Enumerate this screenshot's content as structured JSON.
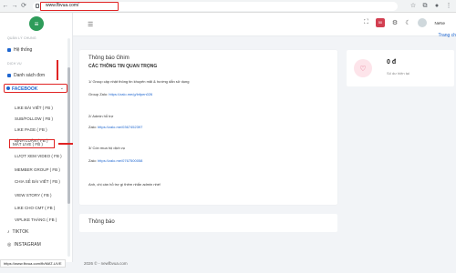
{
  "browser": {
    "url": "www.fbvua.com/",
    "status_url": "https://www.fbvua.com/fb/MAT-LIVE"
  },
  "sidebar": {
    "section_main": "QUẢN LÝ CHUNG",
    "home": "Hệ thống",
    "section_service": "DỊCH VỤ",
    "services_list": "Danh sách đơn",
    "active_group": "FACEBOOK",
    "sub_items": [
      "LIKE BÀI VIẾT ( FB )",
      "SUB/FOLLOW ( FB )",
      "LIKE PAGE ( FB )",
      "BÌNH LUẬN ( FB )",
      "MẮT LIVE ( FB )",
      "LƯỢT XEM VIDEO ( FB )",
      "MEMBER GROUP ( FB )",
      "CHIA SẺ BÀI VIẾT ( FB )",
      "VIEW STORY ( FB )",
      "LIKE CHO CMT ( FB )",
      "VIPLIKE THÁNG ( FB )"
    ],
    "tiktok": "TIKTOK",
    "instagram": "INSTAGRAM"
  },
  "header": {
    "badge": "50",
    "user": "NeNe",
    "link": "Trang ch"
  },
  "main": {
    "title": "Thông báo Ghim",
    "heading": "CÁC THÔNG TIN QUAN TRỌNG",
    "lines": [
      "1/ Group cập nhật thông tin khuyến mãi & hướng dẫn sử dụng",
      "Group Zalo: ",
      "https://zalo.me/g/lnfpen026",
      "2/ Admin hỗ trợ",
      "Zalo: ",
      "https://zalo.me/0367452397",
      "3/ Còn mua hộ dịch vụ",
      "Zalo: ",
      "https://zalo.me/0767500058",
      "Anh, chị cần hỗ trợ gì thêm nhắn admin nhé!"
    ],
    "notice_title": "Thông báo"
  },
  "balance": {
    "amount": "0 đ",
    "label": "Số dư hiện tại"
  },
  "footer": "2026 © - newfbvua.com",
  "colors": {
    "accent": "#1e66d0",
    "annotation": "#e02424",
    "logo": "#2e9c5a"
  }
}
